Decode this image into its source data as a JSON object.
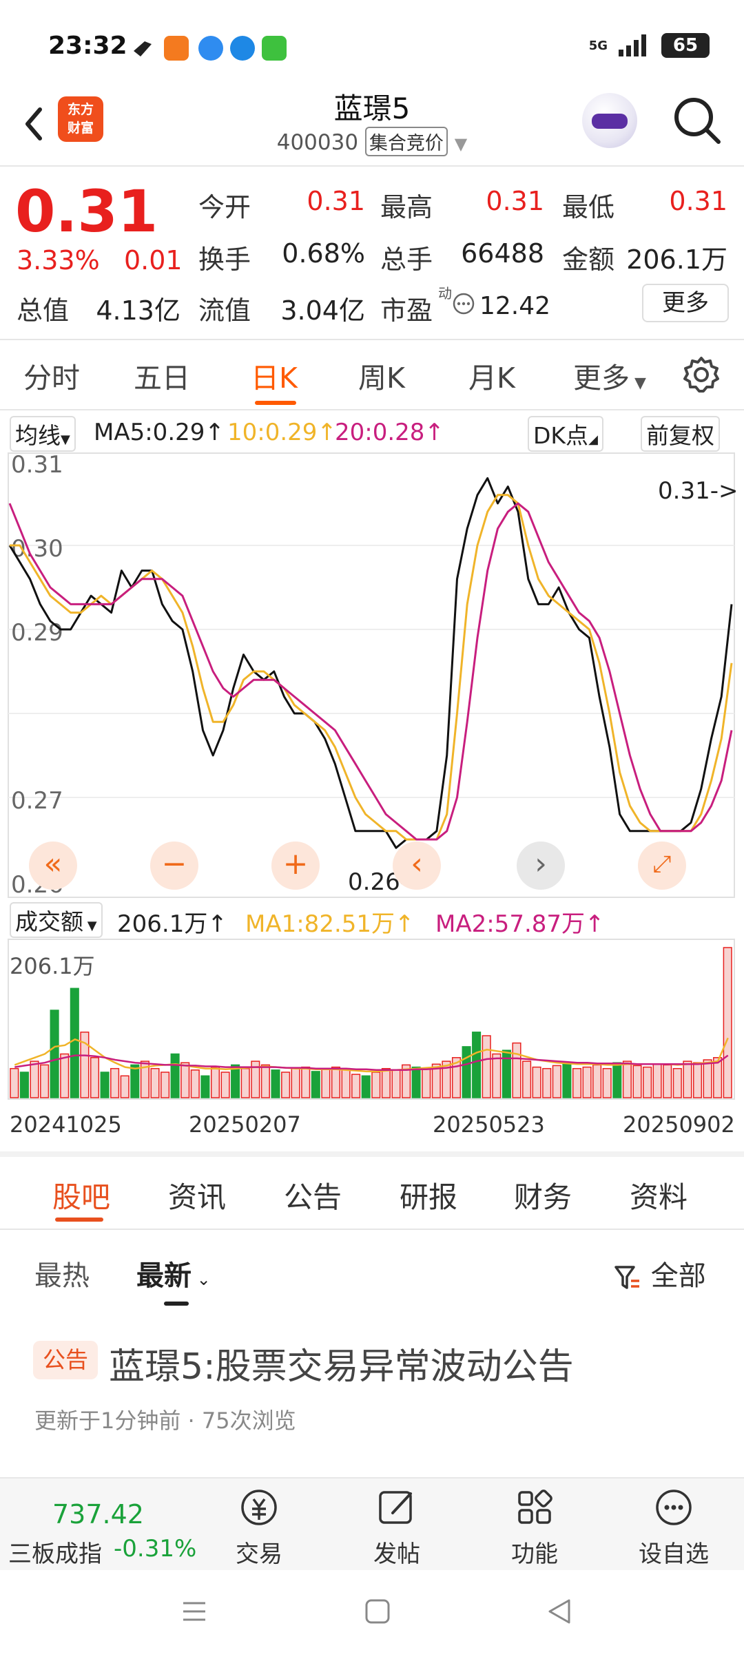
{
  "status_bar": {
    "time": "23:32",
    "network": "5G",
    "battery": "65"
  },
  "header": {
    "brand_logo": "东方\n财富",
    "stock_name": "蓝璟5",
    "stock_code": "400030",
    "auction_badge": "集合竞价"
  },
  "quote": {
    "price": "0.31",
    "change_pct": "3.33%",
    "change_amt": "0.01",
    "open_label": "今开",
    "open": "0.31",
    "high_label": "最高",
    "high": "0.31",
    "low_label": "最低",
    "low": "0.31",
    "turnover_label": "换手",
    "turnover": "0.68%",
    "volume_label": "总手",
    "volume": "66488",
    "amount_label": "金额",
    "amount": "206.1万",
    "total_cap_label": "总值",
    "total_cap": "4.13亿",
    "float_cap_label": "流值",
    "float_cap": "3.04亿",
    "pe_label": "市盈",
    "pe_sup": "动",
    "pe": "12.42",
    "more_button": "更多"
  },
  "period_tabs": [
    "分时",
    "五日",
    "日K",
    "周K",
    "月K",
    "更多"
  ],
  "active_period": "日K",
  "ma_legend": {
    "selector": "均线",
    "ma5": "MA5:0.29↑",
    "ma10": "10:0.29↑",
    "ma20": "20:0.28↑",
    "dk_button": "DK点",
    "adjust_button": "前复权"
  },
  "volume_legend": {
    "selector": "成交额",
    "current": "206.1万↑",
    "ma1": "MA1:82.51万↑",
    "ma2": "MA2:57.87万↑"
  },
  "colors": {
    "up": "#e8201e",
    "down": "#1aa23a",
    "accent": "#ff5a00",
    "ma5": "#111111",
    "ma10": "#f0b429",
    "ma20": "#c81e7e"
  },
  "chart_data": [
    {
      "type": "line",
      "ylim": [
        0.26,
        0.31
      ],
      "y_ticks": [
        "0.31",
        "0.30",
        "0.29",
        "0.27",
        "0.26"
      ],
      "max_label": "0.31->",
      "min_label": "0.26->",
      "series": [
        {
          "name": "MA5",
          "values": [
            0.3,
            0.298,
            0.296,
            0.293,
            0.291,
            0.29,
            0.29,
            0.292,
            0.294,
            0.293,
            0.292,
            0.297,
            0.295,
            0.297,
            0.297,
            0.293,
            0.291,
            0.29,
            0.285,
            0.278,
            0.275,
            0.278,
            0.283,
            0.287,
            0.285,
            0.284,
            0.285,
            0.282,
            0.28,
            0.28,
            0.279,
            0.277,
            0.274,
            0.27,
            0.266,
            0.266,
            0.266,
            0.266,
            0.264,
            0.265,
            0.265,
            0.265,
            0.266,
            0.275,
            0.296,
            0.302,
            0.306,
            0.308,
            0.305,
            0.307,
            0.304,
            0.296,
            0.293,
            0.293,
            0.295,
            0.292,
            0.29,
            0.289,
            0.282,
            0.276,
            0.268,
            0.266,
            0.266,
            0.266,
            0.266,
            0.266,
            0.266,
            0.267,
            0.271,
            0.277,
            0.282,
            0.293
          ]
        },
        {
          "name": "10",
          "values": [
            0.3,
            0.3,
            0.298,
            0.296,
            0.294,
            0.293,
            0.292,
            0.292,
            0.293,
            0.294,
            0.293,
            0.294,
            0.295,
            0.296,
            0.297,
            0.296,
            0.294,
            0.292,
            0.288,
            0.283,
            0.279,
            0.279,
            0.281,
            0.284,
            0.285,
            0.285,
            0.284,
            0.283,
            0.281,
            0.28,
            0.279,
            0.278,
            0.276,
            0.273,
            0.27,
            0.268,
            0.267,
            0.266,
            0.266,
            0.265,
            0.265,
            0.265,
            0.265,
            0.268,
            0.28,
            0.293,
            0.3,
            0.304,
            0.306,
            0.306,
            0.305,
            0.3,
            0.296,
            0.294,
            0.293,
            0.292,
            0.291,
            0.29,
            0.286,
            0.28,
            0.273,
            0.269,
            0.267,
            0.266,
            0.266,
            0.266,
            0.266,
            0.266,
            0.268,
            0.272,
            0.277,
            0.286
          ]
        },
        {
          "name": "20",
          "values": [
            0.305,
            0.302,
            0.299,
            0.297,
            0.295,
            0.294,
            0.293,
            0.293,
            0.293,
            0.293,
            0.293,
            0.294,
            0.295,
            0.296,
            0.296,
            0.296,
            0.295,
            0.294,
            0.291,
            0.288,
            0.285,
            0.283,
            0.282,
            0.283,
            0.284,
            0.284,
            0.284,
            0.283,
            0.282,
            0.281,
            0.28,
            0.279,
            0.278,
            0.276,
            0.274,
            0.272,
            0.27,
            0.268,
            0.267,
            0.266,
            0.265,
            0.265,
            0.265,
            0.266,
            0.27,
            0.279,
            0.289,
            0.297,
            0.302,
            0.304,
            0.305,
            0.304,
            0.301,
            0.298,
            0.296,
            0.294,
            0.292,
            0.291,
            0.289,
            0.285,
            0.28,
            0.275,
            0.271,
            0.268,
            0.266,
            0.266,
            0.266,
            0.266,
            0.267,
            0.269,
            0.272,
            0.278
          ]
        }
      ]
    },
    {
      "type": "bar",
      "title": "成交额",
      "max_label": "206.1万",
      "x_ticks": [
        "20241025",
        "20250207",
        "20250523",
        "20250902"
      ],
      "values": [
        40,
        35,
        50,
        45,
        120,
        60,
        150,
        90,
        55,
        35,
        40,
        30,
        45,
        50,
        40,
        35,
        60,
        48,
        38,
        30,
        42,
        35,
        45,
        40,
        50,
        45,
        38,
        35,
        40,
        42,
        36,
        40,
        42,
        38,
        32,
        30,
        35,
        40,
        38,
        45,
        42,
        40,
        46,
        50,
        55,
        70,
        90,
        85,
        60,
        65,
        75,
        50,
        42,
        40,
        44,
        46,
        40,
        42,
        45,
        40,
        48,
        50,
        44,
        42,
        46,
        45,
        40,
        50,
        48,
        52,
        55,
        206
      ],
      "direction": [
        "u",
        "d",
        "u",
        "u",
        "d",
        "u",
        "d",
        "u",
        "u",
        "d",
        "u",
        "u",
        "d",
        "u",
        "u",
        "u",
        "d",
        "u",
        "u",
        "d",
        "u",
        "u",
        "d",
        "u",
        "u",
        "u",
        "d",
        "u",
        "u",
        "u",
        "d",
        "u",
        "u",
        "u",
        "u",
        "d",
        "u",
        "u",
        "u",
        "u",
        "d",
        "u",
        "u",
        "u",
        "u",
        "d",
        "d",
        "u",
        "u",
        "d",
        "u",
        "u",
        "u",
        "u",
        "u",
        "d",
        "u",
        "u",
        "u",
        "u",
        "d",
        "u",
        "u",
        "u",
        "u",
        "u",
        "u",
        "u",
        "u",
        "u",
        "u",
        "u"
      ],
      "series": [
        {
          "name": "MA1",
          "values": [
            45,
            50,
            55,
            60,
            70,
            72,
            80,
            75,
            65,
            55,
            48,
            42,
            40,
            42,
            44,
            45,
            46,
            44,
            42,
            40,
            40,
            39,
            40,
            41,
            42,
            43,
            42,
            41,
            40,
            40,
            39,
            39,
            39,
            38,
            37,
            36,
            36,
            37,
            38,
            39,
            40,
            41,
            42,
            44,
            48,
            55,
            62,
            66,
            64,
            62,
            60,
            56,
            52,
            50,
            48,
            47,
            46,
            46,
            46,
            45,
            45,
            46,
            46,
            46,
            46,
            46,
            45,
            46,
            47,
            48,
            50,
            82
          ]
        },
        {
          "name": "MA2",
          "values": [
            42,
            44,
            46,
            48,
            52,
            55,
            58,
            58,
            57,
            55,
            52,
            50,
            48,
            47,
            46,
            45,
            45,
            44,
            44,
            43,
            43,
            42,
            42,
            42,
            42,
            42,
            42,
            41,
            41,
            41,
            40,
            40,
            40,
            40,
            39,
            39,
            38,
            38,
            38,
            38,
            39,
            39,
            40,
            41,
            43,
            46,
            50,
            53,
            54,
            54,
            54,
            53,
            52,
            51,
            50,
            49,
            48,
            48,
            47,
            47,
            47,
            47,
            46,
            46,
            46,
            46,
            46,
            46,
            46,
            47,
            48,
            58
          ]
        }
      ]
    }
  ],
  "news_tabs": [
    "股吧",
    "资讯",
    "公告",
    "研报",
    "财务",
    "资料"
  ],
  "feed_sort": {
    "hot": "最热",
    "latest": "最新",
    "filter": "全部"
  },
  "post": {
    "tag": "公告",
    "title": "蓝璟5:股票交易异常波动公告",
    "meta": "更新于1分钟前 · 75次浏览"
  },
  "bottom_bar": {
    "index_value": "737.42",
    "index_name": "三板成指",
    "index_change": "-0.31%",
    "items": [
      "交易",
      "发帖",
      "功能",
      "设自选"
    ]
  }
}
